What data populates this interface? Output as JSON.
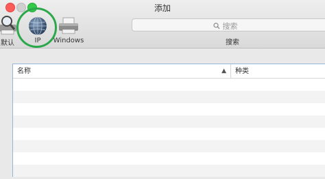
{
  "window": {
    "title": "添加"
  },
  "toolbar": {
    "items": [
      {
        "label": "默认",
        "icon": "default-printer-magnifier-icon"
      },
      {
        "label": "IP",
        "icon": "globe-icon"
      },
      {
        "label": "Windows",
        "icon": "windows-printer-icon"
      }
    ],
    "selected": "IP"
  },
  "search": {
    "placeholder": "搜索",
    "label": "搜索"
  },
  "table": {
    "columns": [
      {
        "label": "名称",
        "sort": "ascending"
      },
      {
        "label": "种类"
      }
    ],
    "rows": []
  },
  "colors": {
    "highlight": "#2aa84a",
    "close": "#fd5d58",
    "zoom": "#35c94a",
    "table_border": "#93b5d9"
  }
}
